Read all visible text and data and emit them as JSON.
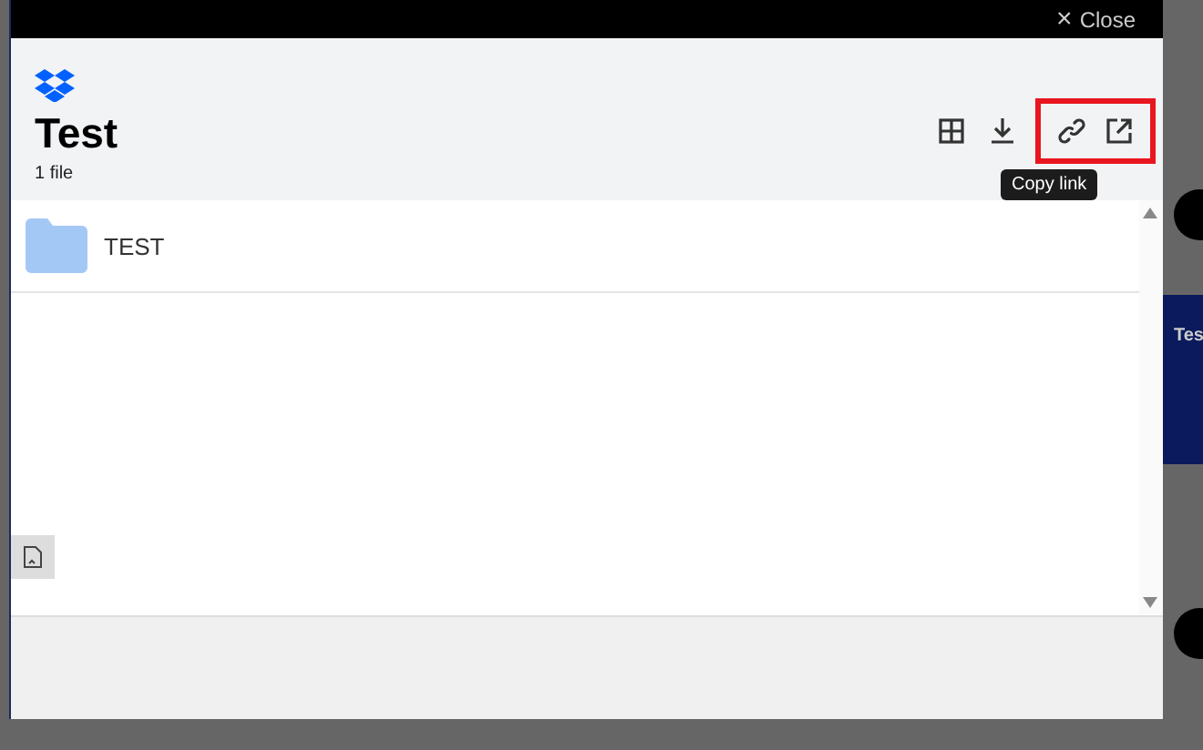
{
  "close_button": {
    "icon": "×",
    "label": "Close"
  },
  "header": {
    "title": "Test",
    "subtitle": "1 file",
    "tooltip": "Copy link",
    "actions": [
      {
        "kind": "grid",
        "highlighted": false
      },
      {
        "kind": "download",
        "highlighted": false
      },
      {
        "kind": "link",
        "highlighted": true
      },
      {
        "kind": "open",
        "highlighted": true
      }
    ]
  },
  "files": [
    {
      "kind": "folder",
      "name": "TEST"
    }
  ],
  "background": {
    "text": "Tes"
  }
}
